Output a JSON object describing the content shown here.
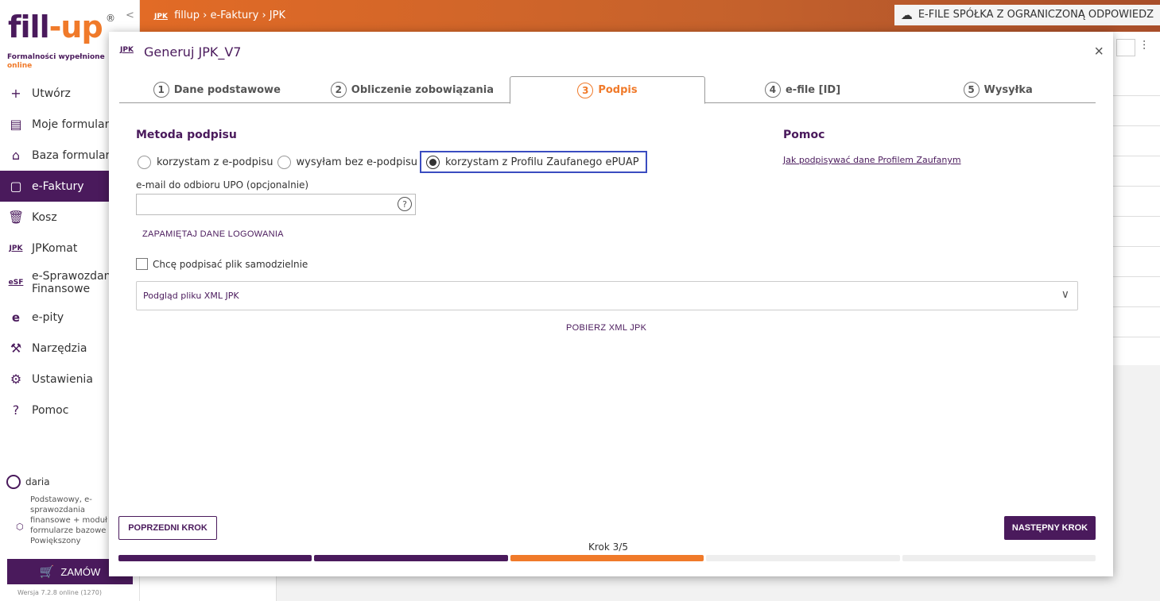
{
  "sidebar": {
    "logo_text_a": "fill",
    "logo_text_dash": "-",
    "logo_text_b": "up",
    "logo_reg": "®",
    "collapse": "<",
    "tagline": "Formalności wypełnione",
    "tagline_online": "online",
    "items": [
      {
        "icon": "+",
        "label": "Utwórz"
      },
      {
        "icon": "▤",
        "label": "Moje formularze"
      },
      {
        "icon": "⌂",
        "label": "Baza formularzy"
      },
      {
        "icon": "▢",
        "label": "e-Faktury"
      },
      {
        "icon": "🗑",
        "label": "Kosz"
      },
      {
        "icon": "JPK",
        "label": "JPKomat"
      },
      {
        "icon": "eSF",
        "label_line1": "e-Sprawozdania",
        "label_line2": "Finansowe"
      },
      {
        "icon": "e",
        "label": "e-pity"
      },
      {
        "icon": "⚒",
        "label": "Narzędzia"
      },
      {
        "icon": "⚙",
        "label": "Ustawienia"
      },
      {
        "icon": "?",
        "label": "Pomoc"
      }
    ],
    "user": "daria",
    "plan_line1": "Podstawowy, e-",
    "plan_line2": "sprawozdania",
    "plan_line3": "finansowe + moduł",
    "plan_line4": "formularze bazowe",
    "plan_line5": "Powiększony",
    "order_label": "ZAMÓW",
    "version": "Wersja 7.2.8 online (1270)"
  },
  "header": {
    "jpk_icon": "JPK",
    "crumb1": "fillup",
    "sep": "›",
    "crumb2": "e-Faktury",
    "crumb3": "JPK",
    "company": "E-FILE SPÓŁKA Z OGRANICZONĄ ODPOWIEDZ"
  },
  "modal": {
    "icon": "JPK",
    "title": "Generuj JPK_V7",
    "close": "×",
    "steps": [
      {
        "num": "1",
        "label": "Dane podstawowe"
      },
      {
        "num": "2",
        "label": "Obliczenie zobowiązania"
      },
      {
        "num": "3",
        "label": "Podpis"
      },
      {
        "num": "4",
        "label": "e-file [ID]"
      },
      {
        "num": "5",
        "label": "Wysyłka"
      }
    ],
    "section_title": "Metoda podpisu",
    "radios": [
      "korzystam z e-podpisu",
      "wysyłam bez e-podpisu",
      "korzystam z Profilu Zaufanego ePUAP"
    ],
    "email_label": "e-mail do odbioru UPO (opcjonalnie)",
    "email_value": "",
    "email_help": "?",
    "save_login": "ZAPAMIĘTAJ DANE LOGOWANIA",
    "checkbox_label": "Chcę podpisać plik samodzielnie",
    "xml_preview": "Podgląd pliku XML JPK",
    "xml_download": "POBIERZ XML JPK",
    "help_title": "Pomoc",
    "help_link": "Jak podpisywać dane Profilem Zaufanym",
    "prev": "POPRZEDNI KROK",
    "next": "NASTĘPNY KROK",
    "step_indicator": "Krok 3/5",
    "progress_current": 3,
    "progress_total": 5
  },
  "colors": {
    "brand": "#4a1a5c",
    "accent": "#f07a2a",
    "selected_outline": "#3a4cc0"
  }
}
